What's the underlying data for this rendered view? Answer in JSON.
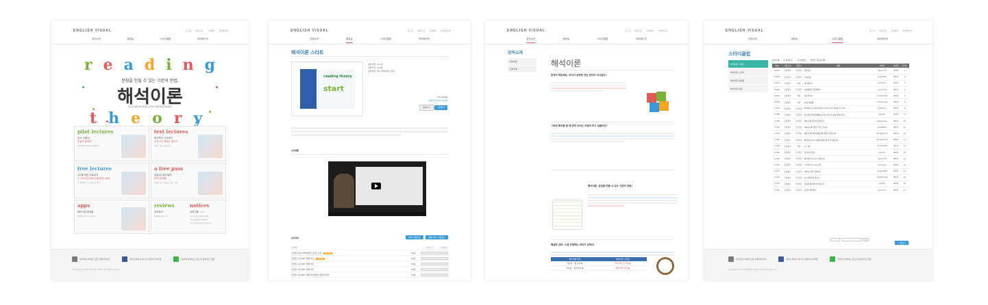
{
  "common": {
    "logo": "ENGLISH VISUAL",
    "toplinks": [
      "로그인",
      "회원가입",
      "고객센터",
      "학습방안내"
    ],
    "nav": [
      "강의소개",
      "결제실",
      "스터디클럽",
      "마이페이지"
    ]
  },
  "panel1": {
    "hero_word_top": "reading",
    "hero_word_bottom": "theory",
    "hero_sub": "문장을 만들 수 있는 기본의 문법,",
    "hero_title": "해석이론",
    "hero_desc": "무너진 독해 영어 체계, 한국어 학원적화에 확여하다",
    "tiles": [
      {
        "title": "pilot lectures",
        "l1": "쉽고 가볍다!",
        "l2": "파일럿 강좌와",
        "l3": "해석이론의 핵심부터 강의하다!",
        "color": "#7ab13a"
      },
      {
        "title": "text lectures",
        "l1": "중고학이 고교까지",
        "l2": "교과서는 해외단 영어도",
        "l3": "영어도 쉬운 가 볼턴다!",
        "color": "#e05a5a"
      },
      {
        "title": "free lectures",
        "l1": "고3을 위한 무료강의",
        "l2": "1. 2014년 EBS 수능특강 36개",
        "l3": "2. 2014년 수능기출 완전 정복",
        "color": "#3a9ad9"
      },
      {
        "title": "a free pass",
        "l1": "잉글리시비주얼의",
        "l2": "모든 강의를",
        "l3": "무제한 자유 수강할 수 있는 기회!",
        "color": "#e05a5a"
      },
      {
        "title": "apps",
        "l1": "해석이론 문장밥",
        "l2": "해석이론 앱 무료 다운로드",
        "l3": "",
        "color": "#e05a5a"
      },
      {
        "title": "reviews",
        "l1": "강의후기",
        "l2": "해석이론 강의 후기",
        "l3": "",
        "color": "#7ab13a"
      }
    ],
    "notice_title": "notices",
    "notice_sub": "공지사항",
    "notice_more": "더보기",
    "notice_items": [
      "[공지] 기존 회원에서 새단..",
      "[공지] 홈페이지 개편안내",
      "[공지] 서비스점검 기간 및 개.."
    ]
  },
  "footer": {
    "items": [
      "영어학원 네이버 오픈 어플리케이션",
      "페이스북에서 만나요 잉글리시비주얼",
      "학습을 선택하는 모든 내 공부습관 연결"
    ],
    "copy": "Copyright (c) 2014 ENGLISH VISUAL. All rights reserved."
  },
  "panel2": {
    "title": "해석이론 스타트",
    "info": [
      "강좌수명: 43시간",
      "강좌기간: 100일",
      "강좌과정: 실시 해석이론 스타트"
    ],
    "price_label": "145,000원",
    "sale_label": "판매가격 145,000원",
    "btn_cart": "장바구니",
    "btn_buy": "구입하기",
    "desc_heading": "강의샘플",
    "list_title": "강의목록",
    "btn_mp3": "MP3 다운로드",
    "btn_all": "활용 MP3 다운로드",
    "list_cols": [
      "강의명",
      "강의시간",
      "강의보기"
    ],
    "lessons": [
      {
        "name": "스타트 Intro 해석이론 스타트 소개",
        "time": "15분",
        "new": "무료강의"
      },
      {
        "name": "스타트 1강 RR1 명령사진",
        "time": "15분",
        "new": "무료강의"
      },
      {
        "name": "스타트 2강 RR1 명령사진",
        "time": "15분",
        "new": ""
      },
      {
        "name": "스타트 3강 RR1 명령사진",
        "time": "15분",
        "new": ""
      },
      {
        "name": "스타트 4강 RR1 명령사진(해석) 준전치어적",
        "time": "15분",
        "new": ""
      }
    ]
  },
  "panel3": {
    "side_title": "강의소개",
    "side_items": [
      "해석이론",
      "강좌계획"
    ],
    "main_title": "해석이론",
    "sections": [
      "한국어 학원체로, 무식이 공부한 것은 영어가 아니었다!",
      "그러데 해석물 할 때 영어 우리는 어떻게 하고 있을까요?",
      "해석이론, 문장을 만들 수 있는 기본의 문법!",
      "해설한 강의, 소셜 연재하는 강의가 강하다!"
    ],
    "table_head": [
      "해석이론 파트",
      "해석이론 스타트"
    ],
    "table_rows": [
      [
        "학습은 / 중 순위 ▶",
        "해석이론 스타트 ▶"
      ],
      [
        "학습은 / 문장해석 ▶",
        "해석이론 파트 ▶"
      ],
      [
        "",
        "해석이론 팟캐스트 ▶"
      ]
    ]
  },
  "panel4": {
    "side_title": "스터디클럽",
    "side_items": [
      "해석이론 서비스",
      "해석이론 스터디",
      "해석이론 해설판",
      "해석이론 외전"
    ],
    "tabs": [
      "분류전체",
      "내 질문보기",
      "내 답변보기",
      "답변할 질문보기▼"
    ],
    "table_cols": [
      "번호",
      "카테고리",
      "질문자",
      "제목",
      "작성자",
      "작성일",
      "조회수"
    ],
    "rows": [
      {
        "no": "19463",
        "cat": "문장해석",
        "asker": "학습질문",
        "title": "질문이요",
        "writer": "user1172",
        "date": "08/03",
        "views": "1"
      },
      {
        "no": "19462",
        "cat": "문장해석",
        "asker": "학습질문",
        "title": "This질문",
        "writer": "english90",
        "date": "08/03",
        "views": "4"
      },
      {
        "no": "19461",
        "cat": "문장해석",
        "asker": "해설",
        "title": "해석이론의",
        "writer": "user0172",
        "date": "08/03",
        "views": "5"
      },
      {
        "no": "19460",
        "cat": "문장해석",
        "asker": "학습질문",
        "title": "ask해당문 질문에 대",
        "writer": "user1179",
        "date": "08/03",
        "views": "2"
      },
      {
        "no": "19459",
        "cat": "문장해석",
        "asker": "해설",
        "title": "질문입니다",
        "writer": "christo1118",
        "date": "08/03",
        "views": "3"
      },
      {
        "no": "19458",
        "cat": "문장해석",
        "asker": "해설",
        "title": "as의 여름에",
        "writer": "christo1118",
        "date": "08/03",
        "views": "6"
      },
      {
        "no": "17893",
        "cat": "문장해석",
        "asker": "학습질문",
        "title": "Imagine a cafe balancing on the edge of a hill",
        "writer": "yeshisong",
        "date": "08/03",
        "views": "9"
      },
      {
        "no": "17386",
        "cat": "문장해석",
        "asker": "학습질문",
        "title": "상단질문 해석하면에서 문자의 강는데 공통적이지 않나",
        "writer": "jjq0191",
        "date": "08/03",
        "views": "13"
      },
      {
        "no": "17386",
        "cat": "문장해석",
        "asker": "학습질문",
        "title": "영어 문제 질문이 있습니다.",
        "writer": "allegamiess",
        "date": "08/03",
        "views": "16"
      },
      {
        "no": "17351",
        "cat": "문장해석",
        "asker": "학습질문",
        "title": "happy 해석질문 부탁드립니다.",
        "writer": "user86821",
        "date": "08/03",
        "views": "15"
      },
      {
        "no": "17352",
        "cat": "문장해석",
        "asker": "학습질문",
        "title": "영종사 와이헤이어에 대해 질문이 있습니다.",
        "writer": "dpnrghzfmf1",
        "date": "08/03",
        "views": "21"
      },
      {
        "no": "17350",
        "cat": "문장해석",
        "asker": "학습질문",
        "title": "해설문이 sol new에 대해 공통을 부탁합니다.",
        "writer": "dpnrghzfmf1",
        "date": "08/03",
        "views": "12"
      },
      {
        "no": "17349",
        "cat": "문장해석",
        "asker": "해설",
        "title": "a드 질문",
        "writer": "hangu0708",
        "date": "08/03",
        "views": "17"
      },
      {
        "no": "17346",
        "cat": "문장해석",
        "asker": "학습질문",
        "title": "문장들의 질문...",
        "writer": "artmoin",
        "date": "08/03",
        "views": "19"
      },
      {
        "no": "17343",
        "cat": "문장해석",
        "asker": "학습질문",
        "title": "해석이론 내 so 관 질문이오.",
        "writer": "arthio378",
        "date": "08/03",
        "views": "22"
      },
      {
        "no": "17342",
        "cat": "문장해석",
        "asker": "학습질문",
        "title": "스카일스 to ring 관련",
        "writer": "yhsoayze",
        "date": "08/03",
        "views": "26"
      },
      {
        "no": "17341",
        "cat": "문장해석",
        "asker": "학습질문",
        "title": "ddlive 관련 질문이요",
        "writer": "hangu0708",
        "date": "08/03",
        "views": "23"
      },
      {
        "no": "17340",
        "cat": "문장해석",
        "asker": "학습질문",
        "title": "sol 관련질문 입니다",
        "writer": "dmaditw160",
        "date": "08/03",
        "views": "24"
      },
      {
        "no": "17339",
        "cat": "문장해석",
        "asker": "학습질문",
        "title": "문장을 해석하나면 입니다?",
        "writer": "jjq0191",
        "date": "08/03",
        "views": "20"
      },
      {
        "no": "17336",
        "cat": "문장해석",
        "asker": "학습질문",
        "title": "문장은 해석질문",
        "writer": "kayus777",
        "date": "08/03",
        "views": "21"
      }
    ],
    "write_btn": "+ 글쓰기",
    "pager": "처음 ‹ 1 2 3 4 5 6 7 8 9 10 › 끝"
  }
}
